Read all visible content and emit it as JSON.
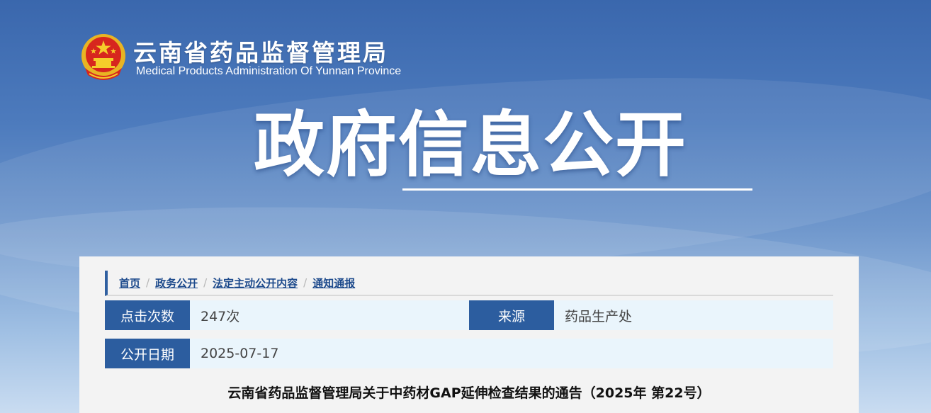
{
  "header": {
    "site_name_cn": "云南省药品监督管理局",
    "site_name_en": "Medical Products Administration Of Yunnan Province",
    "logo_icon": "national-emblem-icon"
  },
  "banner": {
    "title": "政府信息公开"
  },
  "breadcrumb": {
    "items": [
      {
        "label": "首页"
      },
      {
        "label": "政务公开"
      },
      {
        "label": "法定主动公开内容"
      },
      {
        "label": "通知通报"
      }
    ],
    "separator": "/"
  },
  "meta": {
    "views_label": "点击次数",
    "views_value": "247次",
    "source_label": "来源",
    "source_value": "药品生产处",
    "date_label": "公开日期",
    "date_value": "2025-07-17"
  },
  "article": {
    "title": "云南省药品监督管理局关于中药材GAP延伸检查结果的通告（2025年 第22号）"
  },
  "colors": {
    "brand_blue": "#2c5d9f",
    "link_blue": "#1d4a8c",
    "row_bg": "#eaf5fc",
    "panel_bg": "#f3f3f3"
  }
}
